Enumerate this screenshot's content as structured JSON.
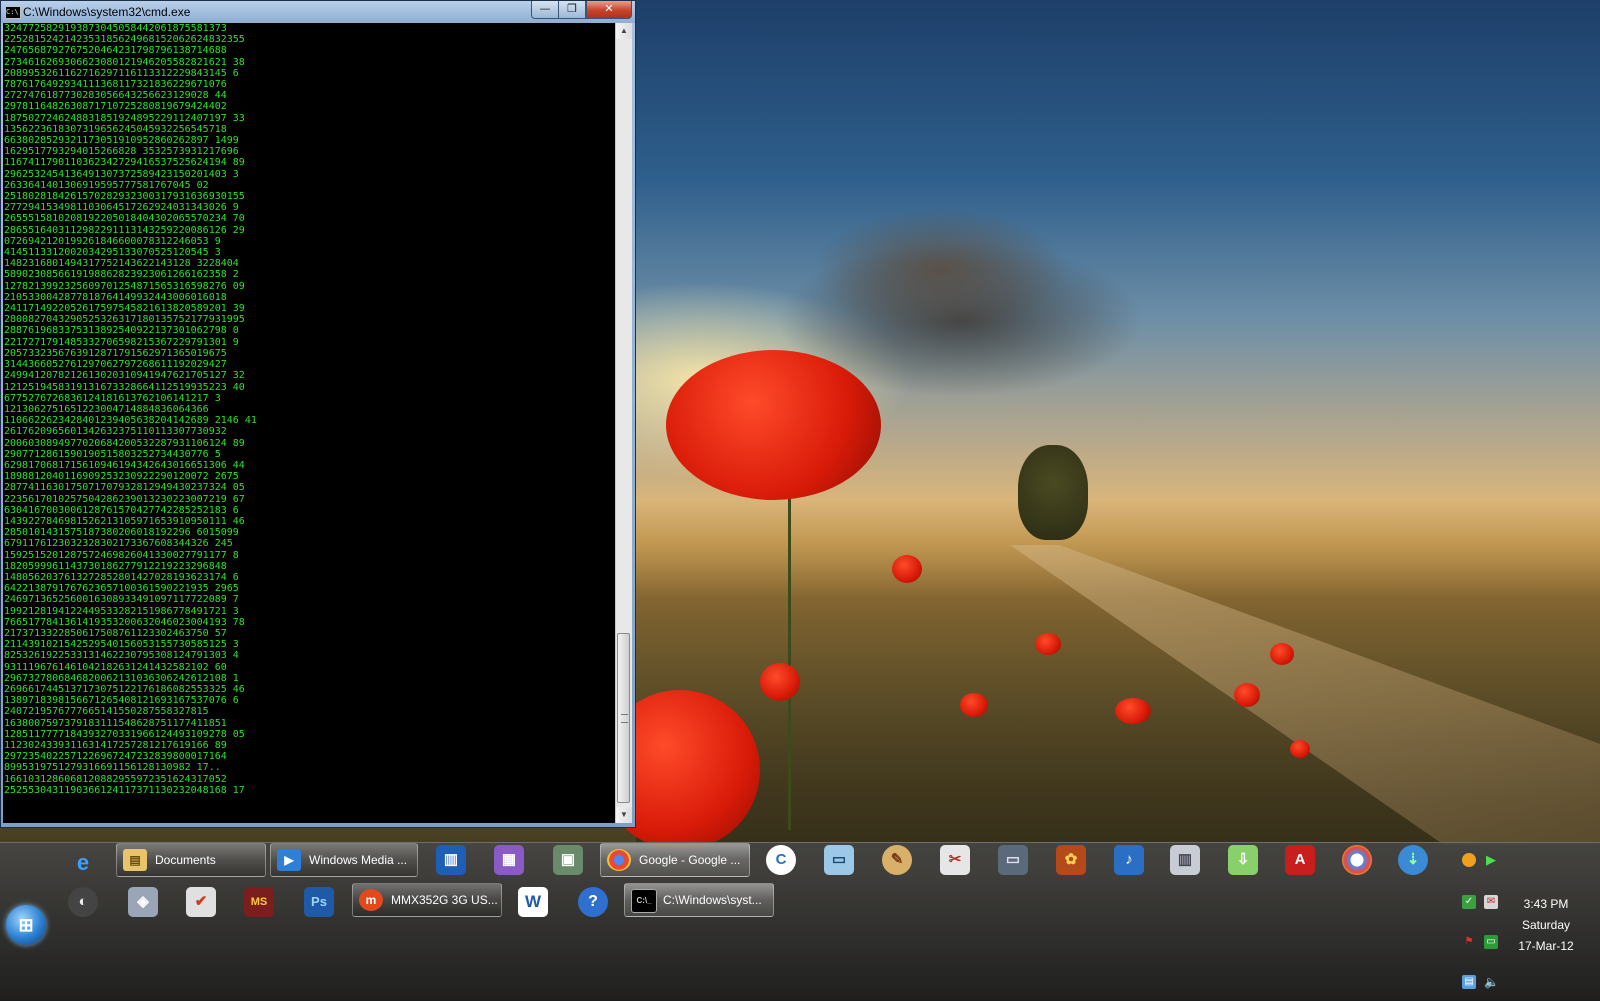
{
  "cmd": {
    "title": "C:\\Windows\\system32\\cmd.exe",
    "icon_text": "C:\\",
    "buttons": {
      "minimize": "—",
      "maximize": "❐",
      "close": "✕"
    },
    "lines": [
      "3247725829193873045058442061875581373",
      "2252815242142353185624968152062624832355",
      "2476568792767520464231798796138714688",
      "2734616269306623080121946205582821621 38",
      "2089953261162716297116113312229843145 6",
      "7876176492934111368117321836229671076",
      "2727476187730283056643256623129028 44",
      "2978116482630871710725280819679424402",
      "1875027246248831851924895229112407197 33",
      "1356223618307319656245045932256545718",
      "6638028529321173051910952860262897 1499",
      "1629517793294015266828 3532573931217696",
      "1167411790110362342729416537525624194 89",
      "2962532454136491307372589423150201403 3",
      "2633641401306919595777581767045 02",
      "2518028184261570282932300317931636930155",
      "2772941534981103064517262924031343026 9",
      "2655515810208192205018404302065570234 70",
      "2865516403112982291113143259220086126 29",
      "0726942120199261846600078312246053 9",
      "4145113312002034295133070525120545 3",
      "1482316801494317752143622143128 3228404",
      "5890230856619198862823923061266162358 2",
      "1278213992325609701254871565316598276 09",
      "2105330042877818764149932443006016018",
      "2411714922052617597545821613820589201 39",
      "2800827043290525326317180135752177931995",
      "2887619683375313892540922137301062798 0",
      "2217271791485332706598215367229791301 9",
      "2057332356763912871791562971365019675",
      "3144366052761297062797268611192029427",
      "2499412078212613020310941947621705127 32",
      "1212519458319131673328664112519935223 40",
      "6775276726836124181613762106141217 3",
      "1213062751651223004714884836064366",
      "1106622623428401239405638204142689 2146 41",
      "2617620965601342632375110113307730932",
      "2006030894977020684200532287931106124 89",
      "2907712861590190515803252734430776 5",
      "6298170681715610946194342643016651306 44",
      "1898812040116909253230922290120072 2675",
      "2877411630175071707932812949430237324 05",
      "2235617010257504286239013230223007219 67",
      "6304167003006128761570427742285252183 6",
      "1439227846981526213105971653910950111 46",
      "2850101431575187380206018192296 6015099",
      "6791176123032328302173367608344326 245",
      "1592515201287572469826041330027791177 8",
      "1820599961143730186277912219223296848",
      "1480562037613272852801427028193623174 6",
      "6422138791767623657100361590221935 2965",
      "2469713652560016308933491097117722089 7",
      "1992128194122449533282151986778491721 3",
      "7665177841361419353200632046023004193 78",
      "2173713322850617508761123302463750 57",
      "2114391021542529540156053155730585125 3",
      "8253261922533131462230795308124791303 4",
      "9311196761461042182631241432582102 60",
      "2967327806846820062131036306242612108 1",
      "2696617445137173075122176186082553325 46",
      "1389718398156671265408121693167537076 6",
      "2407219576777665141550287558327815",
      "1638007597379183111548628751177411851",
      "1285117777184393270331966124493109278 05",
      "1123024339311631417257281217619166 89",
      "2972354022571226967247232839800017164",
      "8995319751279316691156128130982 17..",
      "1661031286068120882955972351624317052",
      "2525530431190366124117371130232048168 17"
    ]
  },
  "taskbar": {
    "row1": [
      {
        "id": "documents",
        "label": "Documents",
        "icon": "folder-icon",
        "color": "#e8c56a"
      },
      {
        "id": "windows-media",
        "label": "Windows Media ...",
        "icon": "media-player-icon",
        "color": "#2f7fd6"
      },
      {
        "id": "google-chrome",
        "label": "Google - Google ...",
        "icon": "chrome-icon",
        "color": "#3c9a3c"
      }
    ],
    "row2": [
      {
        "id": "mmx",
        "label": "MMX352G 3G US...",
        "icon": "modem-icon",
        "color": "#e24a1e"
      },
      {
        "id": "cmd",
        "label": "C:\\Windows\\syst...",
        "icon": "cmd-icon",
        "color": "#000000"
      }
    ]
  },
  "tray": {
    "time": "3:43 PM",
    "day": "Saturday",
    "date": "17-Mar-12"
  }
}
